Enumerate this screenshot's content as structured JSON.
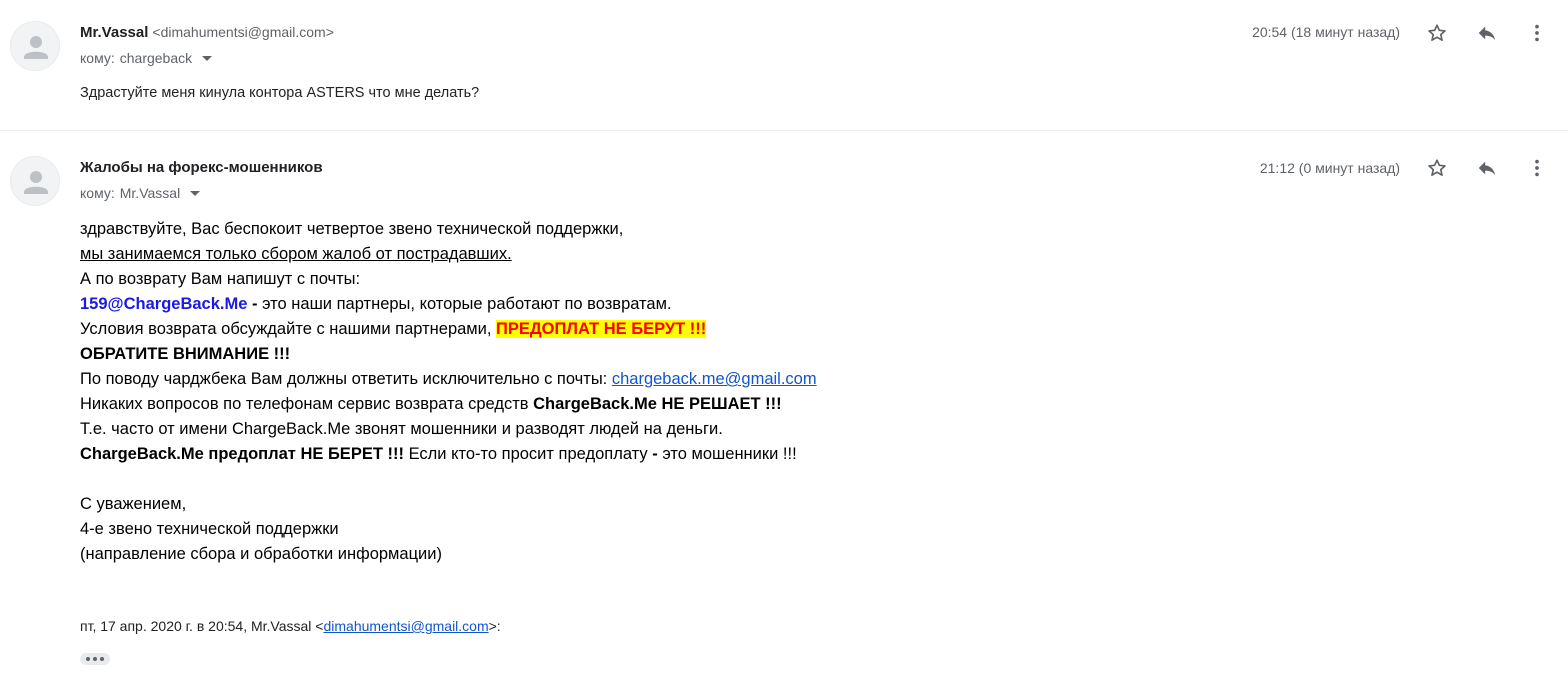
{
  "messages": [
    {
      "sender_name": "Mr.Vassal",
      "sender_email": "<dimahumentsi@gmail.com>",
      "to_label": "кому:",
      "to_value": "chargeback",
      "timestamp": "20:54 (18 минут назад)",
      "snippet": "Здрастуйте меня кинула контора ASTERS что мне делать?"
    },
    {
      "sender_name": "Жалобы на форекс-мошенников",
      "to_label": "кому:",
      "to_value": "Mr.Vassal",
      "timestamp": "21:12 (0 минут назад)",
      "body": {
        "l1": "здравствуйте, Вас беспокоит четвертое звено технической поддержки,",
        "l2": "мы занимаемся только сбором жалоб от пострадавших.",
        "l3": "А по возврату Вам напишут с почты:",
        "l4_email": "159@ChargeBack.Me",
        "l4_dash": " - ",
        "l4_rest": "это наши партнеры, которые работают по возвратам.",
        "l5_text": "Условия возврата обсуждайте с нашими партнерами, ",
        "l5_highlight": "ПРЕДОПЛАТ НЕ БЕРУТ !!!",
        "l6": "ОБРАТИТЕ ВНИМАНИЕ !!!",
        "l7_text": "По поводу чарджбека Вам должны ответить исключительно с почты: ",
        "l7_link": "chargeback.me@gmail.com",
        "l8_text": "Никаких вопросов по телефонам сервис возврата средств ",
        "l8_bold": "ChargeBack.Me НЕ РЕШАЕТ !!!",
        "l9": "Т.е. часто от имени ChargeBack.Me звонят мошенники и разводят людей на деньги.",
        "l10_bold": "ChargeBack.Me предоплат НЕ БЕРЕТ !!!",
        "l10_text1": " Если кто-то просит предоплату ",
        "l10_dash": "-",
        "l10_text2": " это мошенники !!!",
        "sig1": "С уважением,",
        "sig2": "4-е звено технической поддержки",
        "sig3": "(направление сбора и обработки информации)"
      },
      "quote_prefix": "пт, 17 апр. 2020 г. в 20:54, Mr.Vassal <",
      "quote_email": "dimahumentsi@gmail.com",
      "quote_suffix": ">:"
    }
  ],
  "icons": [
    "avatar-icon",
    "star-icon",
    "reply-icon",
    "more-vert-icon",
    "dropdown-caret-icon",
    "show-trimmed-content-icon"
  ],
  "colors": {
    "highlight_bg": "#ffff00",
    "highlight_text": "#ff0000",
    "email_blue": "#1a19e6",
    "link": "#1155cc",
    "meta_gray": "#5f6368"
  }
}
